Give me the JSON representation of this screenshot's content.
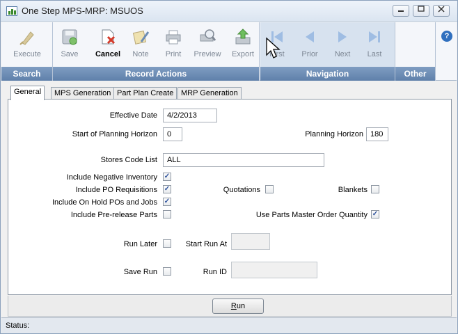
{
  "window": {
    "title": "One Step MPS-MRP: MSUOS"
  },
  "title_buttons": [
    "minimize",
    "maximize",
    "close"
  ],
  "toolbar": {
    "groups": [
      {
        "name": "Search",
        "items": [
          {
            "label": "Execute",
            "icon": "execute-icon",
            "enabled": false
          }
        ]
      },
      {
        "name": "Record Actions",
        "items": [
          {
            "label": "Save",
            "icon": "save-icon",
            "enabled": false
          },
          {
            "label": "Cancel",
            "icon": "cancel-icon",
            "enabled": true
          },
          {
            "label": "Note",
            "icon": "note-icon",
            "enabled": false
          },
          {
            "label": "Print",
            "icon": "print-icon",
            "enabled": false
          },
          {
            "label": "Preview",
            "icon": "preview-icon",
            "enabled": false
          },
          {
            "label": "Export",
            "icon": "export-icon",
            "enabled": false
          }
        ]
      },
      {
        "name": "Navigation",
        "items": [
          {
            "label": "First",
            "icon": "first-icon",
            "enabled": false
          },
          {
            "label": "Prior",
            "icon": "prior-icon",
            "enabled": false
          },
          {
            "label": "Next",
            "icon": "next-icon",
            "enabled": false
          },
          {
            "label": "Last",
            "icon": "last-icon",
            "enabled": false
          }
        ]
      },
      {
        "name": "Other",
        "items": []
      }
    ],
    "help": "?"
  },
  "tabs": [
    "General",
    "MPS Generation",
    "Part Plan Create",
    "MRP Generation"
  ],
  "active_tab": "General",
  "form": {
    "effective_date": {
      "label": "Effective Date",
      "value": "4/2/2013"
    },
    "start_planning": {
      "label": "Start of Planning Horizon",
      "value": "0"
    },
    "planning_horizon": {
      "label": "Planning Horizon",
      "value": "180"
    },
    "stores_code": {
      "label": "Stores Code List",
      "value": "ALL"
    },
    "include_negative": {
      "label": "Include Negative Inventory",
      "checked": true
    },
    "include_po_req": {
      "label": "Include PO Requisitions",
      "checked": true
    },
    "quotations": {
      "label": "Quotations",
      "checked": false
    },
    "blankets": {
      "label": "Blankets",
      "checked": false
    },
    "include_on_hold": {
      "label": "Include On Hold POs and Jobs",
      "checked": true
    },
    "include_prerelease": {
      "label": "Include Pre-release Parts",
      "checked": false
    },
    "use_parts_master": {
      "label": "Use Parts Master Order Quantity",
      "checked": true
    },
    "run_later": {
      "label": "Run Later",
      "checked": false
    },
    "start_run_at": {
      "label": "Start Run At",
      "value": ""
    },
    "save_run": {
      "label": "Save Run",
      "checked": false
    },
    "run_id": {
      "label": "Run ID",
      "value": ""
    }
  },
  "run_button": {
    "label": "Run",
    "accelerator": "R"
  },
  "status": {
    "label": "Status:"
  },
  "colors": {
    "group_footer": "#6c8cb5",
    "accent_blue": "#2f6fbe",
    "check_blue": "#2a4f9a"
  }
}
